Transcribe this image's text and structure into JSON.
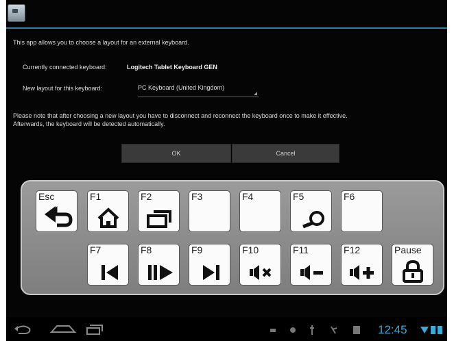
{
  "intro": "This app allows you to choose a layout for an external keyboard.",
  "connected": {
    "label": "Currently connected keyboard:",
    "value": "Logitech Tablet Keyboard GEN"
  },
  "layout": {
    "label": "New layout for this keyboard:",
    "value": "PC Keyboard (United Kingdom)"
  },
  "note_line1": "Please note that after choosing a new layout you have to disconnect and reconnect the keyboard once to make it effective.",
  "note_line2": "Afterwards, the keyboard will be detected automatically.",
  "buttons": {
    "ok": "OK",
    "cancel": "Cancel"
  },
  "keys_row1": [
    {
      "label": "Esc",
      "icon": "back-arrow-icon"
    },
    {
      "label": "F1",
      "icon": "home-icon"
    },
    {
      "label": "F2",
      "icon": "recent-apps-icon"
    },
    {
      "label": "F3",
      "icon": ""
    },
    {
      "label": "F4",
      "icon": ""
    },
    {
      "label": "F5",
      "icon": "search-icon"
    },
    {
      "label": "F6",
      "icon": ""
    }
  ],
  "keys_row2": [
    {
      "label": "F7",
      "icon": "previous-track-icon"
    },
    {
      "label": "F8",
      "icon": "play-pause-icon"
    },
    {
      "label": "F9",
      "icon": "next-track-icon"
    },
    {
      "label": "F10",
      "icon": "mute-icon"
    },
    {
      "label": "F11",
      "icon": "volume-down-icon"
    },
    {
      "label": "F12",
      "icon": "volume-up-icon"
    },
    {
      "label": "Pause",
      "icon": "lock-icon"
    }
  ],
  "status": {
    "time": "12:45"
  },
  "colors": {
    "accent": "#2d7fa3",
    "clock": "#39a9d8"
  }
}
